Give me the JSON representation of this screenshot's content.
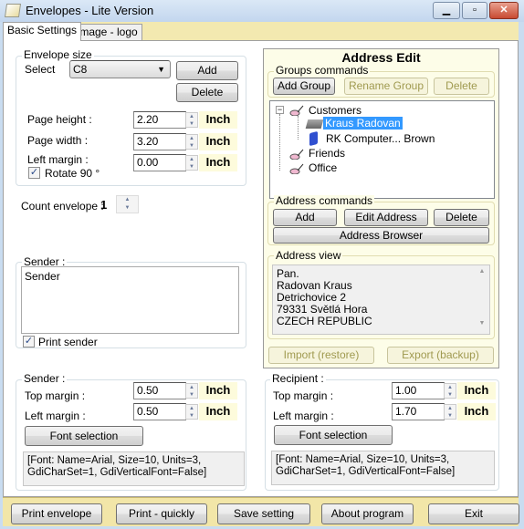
{
  "window": {
    "title": "Envelopes - Lite Version",
    "minimize": "▁",
    "maximize": "▫",
    "close": "✕"
  },
  "tabs": [
    {
      "label": "Basic Settings"
    },
    {
      "label": "Image - logo"
    }
  ],
  "envelope_size": {
    "legend": "Envelope size",
    "select_label": "Select",
    "selected": "C8",
    "add": "Add",
    "delete": "Delete",
    "page_height_label": "Page height :",
    "page_height": "2.20",
    "page_width_label": "Page width :",
    "page_width": "3.20",
    "left_margin_label": "Left margin  :",
    "left_margin": "0.00",
    "unit": "Inch",
    "rotate_label": "Rotate 90 °",
    "rotate_checked": true
  },
  "count": {
    "label": "Count envelope :",
    "value": "1"
  },
  "sender_box": {
    "legend": "Sender :",
    "text": "Sender",
    "print_sender_label": "Print sender",
    "print_sender_checked": true
  },
  "sender_margins": {
    "legend": "Sender :",
    "top_label": "Top margin  :",
    "top": "0.50",
    "left_label": "Left margin :",
    "left": "0.50",
    "unit": "Inch",
    "font_button": "Font selection",
    "font_info": "[Font: Name=Arial, Size=10, Units=3, GdiCharSet=1, GdiVerticalFont=False]"
  },
  "recipient_margins": {
    "legend": "Recipient :",
    "top_label": "Top margin  :",
    "top": "1.00",
    "left_label": "Left margin  :",
    "left": "1.70",
    "unit": "Inch",
    "font_button": "Font selection",
    "font_info": "[Font: Name=Arial, Size=10, Units=3, GdiCharSet=1, GdiVerticalFont=False]"
  },
  "address_edit": {
    "title": "Address Edit",
    "groups_legend": "Groups commands",
    "add_group": "Add Group",
    "rename_group": "Rename Group",
    "delete_group": "Delete",
    "tree": {
      "expander": "−",
      "groups": [
        {
          "label": "Customers",
          "children": [
            {
              "label": "Kraus Radovan",
              "selected": true
            },
            {
              "label": "RK Computer... Brown"
            }
          ]
        },
        {
          "label": "Friends"
        },
        {
          "label": "Office"
        }
      ]
    },
    "address_legend": "Address commands",
    "add": "Add",
    "edit": "Edit Address",
    "delete": "Delete",
    "browser": "Address Browser",
    "view_legend": "Address view",
    "view_lines": [
      "Pan.",
      "Radovan  Kraus",
      "Detrichovice  2",
      "79331  Světlá Hora",
      "CZECH REPUBLIC"
    ],
    "import": "Import (restore)",
    "export": "Export (backup)"
  },
  "bottom": {
    "print": "Print envelope",
    "print_quick": "Print - quickly",
    "save": "Save setting",
    "about": "About program",
    "exit": "Exit"
  },
  "colors": {
    "selection": "#3399ff",
    "tabstrip": "#f3e9b0",
    "bottombar": "#f2e6a8",
    "disabled_text": "#a09a50"
  }
}
